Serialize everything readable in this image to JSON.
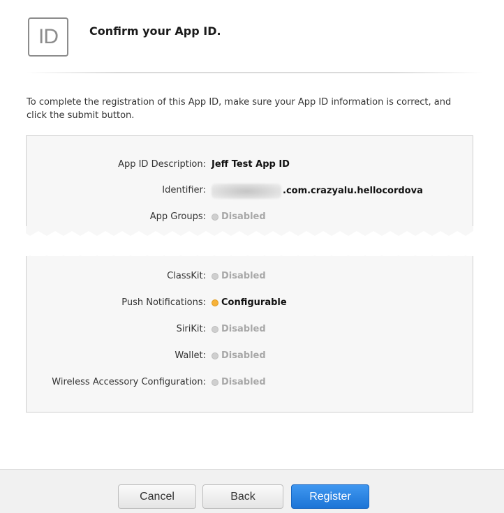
{
  "header": {
    "icon_text": "ID",
    "title": "Confirm your App ID."
  },
  "instructions": "To complete the registration of this App ID, make sure your App ID information is correct, and click the submit button.",
  "details": {
    "description": {
      "label": "App ID Description:",
      "value": "Jeff Test App ID"
    },
    "identifier": {
      "label": "Identifier:",
      "value": ".com.crazyalu.hellocordova"
    },
    "app_groups": {
      "label": "App Groups:",
      "value": "Disabled"
    },
    "classkit": {
      "label": "ClassKit:",
      "value": "Disabled"
    },
    "push": {
      "label": "Push Notifications:",
      "value": "Configurable"
    },
    "sirikit": {
      "label": "SiriKit:",
      "value": "Disabled"
    },
    "wallet": {
      "label": "Wallet:",
      "value": "Disabled"
    },
    "wireless": {
      "label": "Wireless Accessory Configuration:",
      "value": "Disabled"
    }
  },
  "footer": {
    "cancel_label": "Cancel",
    "back_label": "Back",
    "register_label": "Register"
  },
  "colors": {
    "accent": "#2a85e6",
    "configurable_dot": "#f6b23a",
    "disabled_text": "#a8a8a8"
  }
}
